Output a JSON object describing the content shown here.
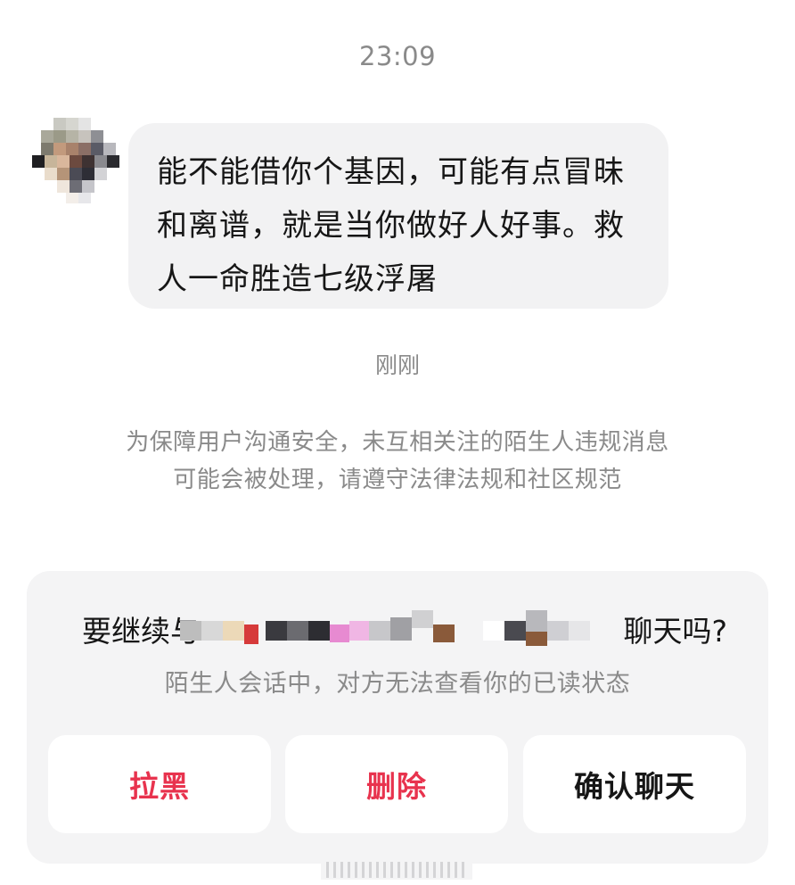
{
  "header": {
    "time": "23:09"
  },
  "message": {
    "avatar_icon": "blurred-avatar-icon",
    "text": "能不能借你个基因，可能有点冒昧和离谱，就是当你做好人好事。救人一命胜造七级浮屠",
    "time_label": "刚刚"
  },
  "notice": {
    "text": "为保障用户沟通安全，未互相关注的陌生人违规消息可能会被处理，请遵守法律法规和社区规范"
  },
  "panel": {
    "title_prefix": "要继续与",
    "title_suffix": "聊天吗?",
    "subtitle": "陌生人会话中，对方无法查看你的已读状态",
    "buttons": {
      "block": "拉黑",
      "delete": "删除",
      "confirm": "确认聊天"
    },
    "colors": {
      "danger": "#e8334e",
      "panel_bg": "#f4f4f5",
      "bubble_bg": "#f2f2f3"
    }
  }
}
